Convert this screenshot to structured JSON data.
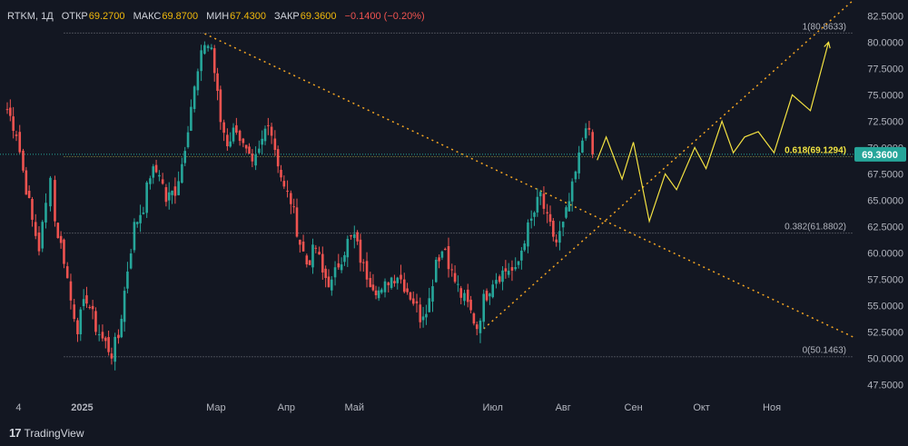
{
  "legend": {
    "symbol": "RTKM",
    "interval": "1Д",
    "open_label": "ОТКР",
    "open": "69.2700",
    "high_label": "МАКС",
    "high": "69.8700",
    "low_label": "МИН",
    "low": "67.4300",
    "close_label": "ЗАКР",
    "close": "69.3600",
    "change": "−0.1400 (−0.20%)"
  },
  "brand": {
    "name": "TradingView",
    "logo": "tradingview-logo"
  },
  "colors": {
    "background": "#131722",
    "up": "#26a69a",
    "down": "#ef5350",
    "trendline": "#f5a623",
    "projection": "#f5e342",
    "fib_line": "#9598a1",
    "price_line": "#26a69a",
    "axis_text": "#b2b5be"
  },
  "chart_data": {
    "type": "candlestick",
    "title": "",
    "ylim": [
      46.5,
      84.0
    ],
    "y_ticks": [
      47.5,
      50.0,
      52.5,
      55.0,
      57.5,
      60.0,
      62.5,
      65.0,
      67.5,
      70.0,
      72.5,
      75.0,
      77.5,
      80.0,
      82.5
    ],
    "y_tick_labels": [
      "47.5000",
      "50.0000",
      "52.5000",
      "55.0000",
      "57.5000",
      "60.0000",
      "62.5000",
      "65.0000",
      "67.5000",
      "70.0000",
      "72.5000",
      "75.0000",
      "77.5000",
      "80.0000",
      "82.5000"
    ],
    "x_range": [
      "2024-11-29",
      "2025-12-07"
    ],
    "x_ticks": [
      {
        "date": "2024-12-04",
        "label": "4"
      },
      {
        "date": "2025-01-01",
        "label": "2025"
      },
      {
        "date": "2025-03-01",
        "label": "Мар"
      },
      {
        "date": "2025-04-01",
        "label": "Апр"
      },
      {
        "date": "2025-05-01",
        "label": "Май"
      },
      {
        "date": "2025-07-01",
        "label": "Июл"
      },
      {
        "date": "2025-08-01",
        "label": "Авг"
      },
      {
        "date": "2025-09-01",
        "label": "Сен"
      },
      {
        "date": "2025-10-01",
        "label": "Окт"
      },
      {
        "date": "2025-11-01",
        "label": "Ноя"
      }
    ],
    "closes": [
      {
        "date": "2024-11-29",
        "value": 73.6
      },
      {
        "date": "2024-12-03",
        "value": 71.5
      },
      {
        "date": "2024-12-06",
        "value": 67.8
      },
      {
        "date": "2024-12-10",
        "value": 63.0
      },
      {
        "date": "2024-12-13",
        "value": 60.5
      },
      {
        "date": "2024-12-16",
        "value": 64.5
      },
      {
        "date": "2024-12-18",
        "value": 67.8
      },
      {
        "date": "2024-12-20",
        "value": 63.0
      },
      {
        "date": "2024-12-24",
        "value": 59.5
      },
      {
        "date": "2024-12-27",
        "value": 55.5
      },
      {
        "date": "2024-12-30",
        "value": 53.0
      },
      {
        "date": "2025-01-03",
        "value": 55.8
      },
      {
        "date": "2025-01-07",
        "value": 53.0
      },
      {
        "date": "2025-01-10",
        "value": 51.8
      },
      {
        "date": "2025-01-14",
        "value": 50.5
      },
      {
        "date": "2025-01-17",
        "value": 52.0
      },
      {
        "date": "2025-01-21",
        "value": 58.5
      },
      {
        "date": "2025-01-24",
        "value": 62.5
      },
      {
        "date": "2025-01-28",
        "value": 64.5
      },
      {
        "date": "2025-01-31",
        "value": 67.5
      },
      {
        "date": "2025-02-04",
        "value": 67.8
      },
      {
        "date": "2025-02-07",
        "value": 65.0
      },
      {
        "date": "2025-02-11",
        "value": 66.0
      },
      {
        "date": "2025-02-14",
        "value": 68.5
      },
      {
        "date": "2025-02-18",
        "value": 74.0
      },
      {
        "date": "2025-02-21",
        "value": 77.0
      },
      {
        "date": "2025-02-24",
        "value": 80.0
      },
      {
        "date": "2025-02-27",
        "value": 79.5
      },
      {
        "date": "2025-03-03",
        "value": 72.5
      },
      {
        "date": "2025-03-06",
        "value": 70.5
      },
      {
        "date": "2025-03-10",
        "value": 72.0
      },
      {
        "date": "2025-03-13",
        "value": 70.0
      },
      {
        "date": "2025-03-17",
        "value": 68.0
      },
      {
        "date": "2025-03-20",
        "value": 69.5
      },
      {
        "date": "2025-03-24",
        "value": 72.8
      },
      {
        "date": "2025-03-27",
        "value": 70.0
      },
      {
        "date": "2025-03-31",
        "value": 66.0
      },
      {
        "date": "2025-04-03",
        "value": 65.0
      },
      {
        "date": "2025-04-07",
        "value": 61.0
      },
      {
        "date": "2025-04-10",
        "value": 59.0
      },
      {
        "date": "2025-04-14",
        "value": 60.5
      },
      {
        "date": "2025-04-17",
        "value": 58.0
      },
      {
        "date": "2025-04-21",
        "value": 57.0
      },
      {
        "date": "2025-04-24",
        "value": 59.0
      },
      {
        "date": "2025-04-28",
        "value": 61.0
      },
      {
        "date": "2025-05-01",
        "value": 61.5
      },
      {
        "date": "2025-05-05",
        "value": 58.5
      },
      {
        "date": "2025-05-08",
        "value": 57.5
      },
      {
        "date": "2025-05-13",
        "value": 56.0
      },
      {
        "date": "2025-05-16",
        "value": 57.5
      },
      {
        "date": "2025-05-20",
        "value": 58.0
      },
      {
        "date": "2025-05-23",
        "value": 57.0
      },
      {
        "date": "2025-05-27",
        "value": 55.5
      },
      {
        "date": "2025-05-30",
        "value": 54.0
      },
      {
        "date": "2025-06-03",
        "value": 55.5
      },
      {
        "date": "2025-06-06",
        "value": 59.5
      },
      {
        "date": "2025-06-10",
        "value": 60.5
      },
      {
        "date": "2025-06-13",
        "value": 58.0
      },
      {
        "date": "2025-06-17",
        "value": 56.0
      },
      {
        "date": "2025-06-20",
        "value": 55.0
      },
      {
        "date": "2025-06-24",
        "value": 53.0
      },
      {
        "date": "2025-06-27",
        "value": 55.5
      },
      {
        "date": "2025-07-01",
        "value": 57.5
      },
      {
        "date": "2025-07-04",
        "value": 58.0
      },
      {
        "date": "2025-07-08",
        "value": 58.5
      },
      {
        "date": "2025-07-11",
        "value": 58.0
      },
      {
        "date": "2025-07-15",
        "value": 61.5
      },
      {
        "date": "2025-07-18",
        "value": 63.0
      },
      {
        "date": "2025-07-22",
        "value": 65.5
      },
      {
        "date": "2025-07-25",
        "value": 63.0
      },
      {
        "date": "2025-07-29",
        "value": 61.0
      },
      {
        "date": "2025-08-01",
        "value": 62.5
      },
      {
        "date": "2025-08-05",
        "value": 66.0
      },
      {
        "date": "2025-08-08",
        "value": 69.0
      },
      {
        "date": "2025-08-11",
        "value": 72.5
      },
      {
        "date": "2025-08-14",
        "value": 69.36
      }
    ],
    "price_levels": [
      {
        "label": "1(80.8633)",
        "value": 80.8633
      },
      {
        "label": "0.618(69.1294)",
        "value": 69.1294
      },
      {
        "label": "0.382(61.8802)",
        "value": 61.8802
      },
      {
        "label": "0(50.1463)",
        "value": 50.1463
      }
    ],
    "last_price": {
      "label": "69.3600",
      "value": 69.36
    },
    "drawings": {
      "downtrend_line": [
        {
          "date": "2025-02-24",
          "value": 80.8
        },
        {
          "date": "2025-12-07",
          "value": 52.0
        }
      ],
      "uptrend_line": [
        {
          "date": "2025-06-27",
          "value": 52.8
        },
        {
          "date": "2025-12-07",
          "value": 84.0
        }
      ],
      "projection": [
        {
          "date": "2025-08-16",
          "value": 68.8
        },
        {
          "date": "2025-08-20",
          "value": 71.0
        },
        {
          "date": "2025-08-27",
          "value": 67.0
        },
        {
          "date": "2025-09-01",
          "value": 70.5
        },
        {
          "date": "2025-09-08",
          "value": 63.0
        },
        {
          "date": "2025-09-15",
          "value": 67.5
        },
        {
          "date": "2025-09-20",
          "value": 66.0
        },
        {
          "date": "2025-09-28",
          "value": 70.0
        },
        {
          "date": "2025-10-03",
          "value": 68.0
        },
        {
          "date": "2025-10-10",
          "value": 72.5
        },
        {
          "date": "2025-10-15",
          "value": 69.5
        },
        {
          "date": "2025-10-20",
          "value": 71.0
        },
        {
          "date": "2025-10-26",
          "value": 71.5
        },
        {
          "date": "2025-11-02",
          "value": 69.5
        },
        {
          "date": "2025-11-10",
          "value": 75.0
        },
        {
          "date": "2025-11-18",
          "value": 73.5
        },
        {
          "date": "2025-11-26",
          "value": 80.0
        }
      ]
    }
  }
}
